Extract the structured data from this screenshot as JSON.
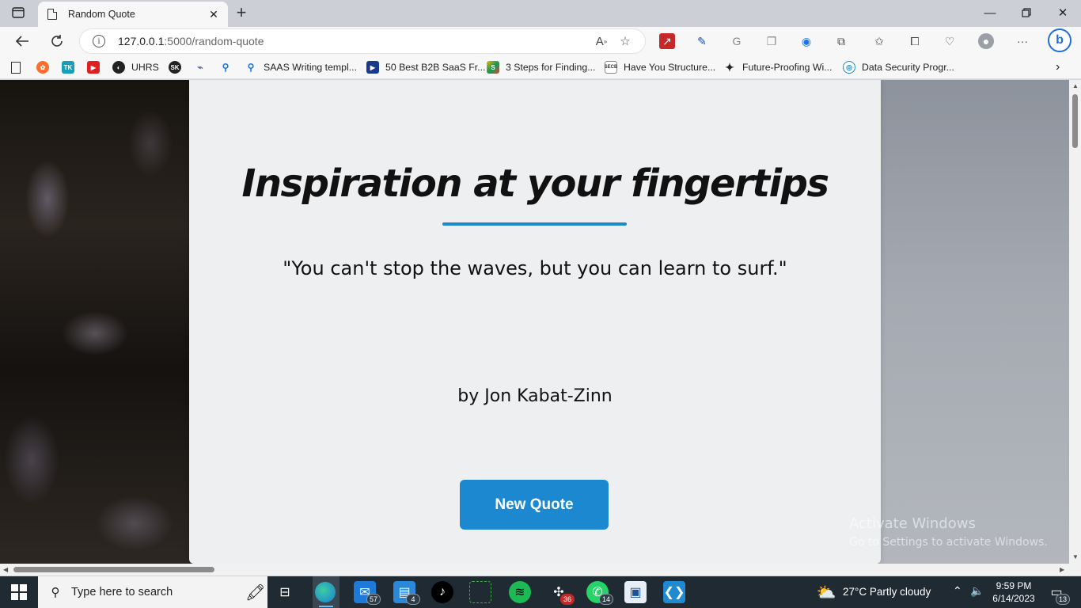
{
  "browser": {
    "tab": {
      "title": "Random Quote"
    },
    "address": {
      "host": "127.0.0.1",
      "path": ":5000/random-quote"
    },
    "bookmarks": [
      {
        "label": "UHRS"
      },
      {
        "label": "SAAS Writing templ..."
      },
      {
        "label": "50 Best B2B SaaS Fr..."
      },
      {
        "label": "3 Steps for Finding..."
      },
      {
        "label": "Have You Structure..."
      },
      {
        "label": "Future-Proofing Wi..."
      },
      {
        "label": "Data Security Progr..."
      }
    ]
  },
  "page": {
    "title": "Inspiration at your fingertips",
    "quote": "\"You can't stop the waves, but you can learn to surf.\"",
    "author": "by Jon Kabat-Zinn",
    "button_label": "New Quote",
    "accent_color": "#1b88cf"
  },
  "watermark": {
    "line1": "Activate Windows",
    "line2": "Go to Settings to activate Windows."
  },
  "taskbar": {
    "search_placeholder": "Type here to search",
    "badges": {
      "mail": "57",
      "app": "4",
      "slack": "36",
      "whatsapp": "14"
    },
    "weather": "27°C  Partly cloudy",
    "time": "9:59 PM",
    "date": "6/14/2023",
    "notifications": "13"
  }
}
